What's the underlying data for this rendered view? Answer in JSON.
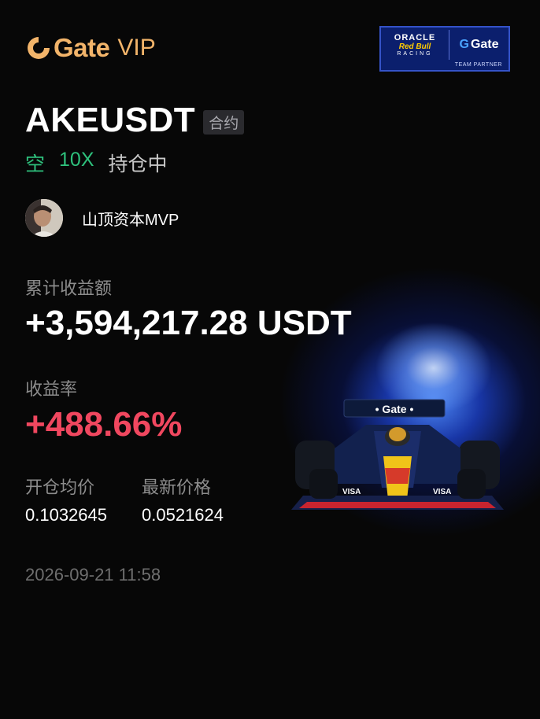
{
  "brand": {
    "name": "Gate",
    "tier": "VIP",
    "accent": "#f2b46a"
  },
  "partner": {
    "oracle": "ORACLE",
    "redbull": "Red Bull",
    "racing": "RACING",
    "gate": "Gate",
    "caption": "TEAM PARTNER"
  },
  "position": {
    "pair": "AKEUSDT",
    "type_badge": "合约",
    "side": "空",
    "leverage": "10X",
    "status": "持仓中"
  },
  "user": {
    "name": "山顶资本MVP"
  },
  "stats": {
    "cum_profit_label": "累计收益额",
    "cum_profit_value": "+3,594,217.28 USDT",
    "rate_label": "收益率",
    "rate_value": "+488.66%",
    "entry_label": "开仓均价",
    "entry_value": "0.1032645",
    "last_label": "最新价格",
    "last_value": "0.0521624"
  },
  "timestamp": "2026-09-21 11:58",
  "colors": {
    "positive_green": "#2ec07c",
    "rate_red": "#f0475f",
    "background": "#070707"
  }
}
